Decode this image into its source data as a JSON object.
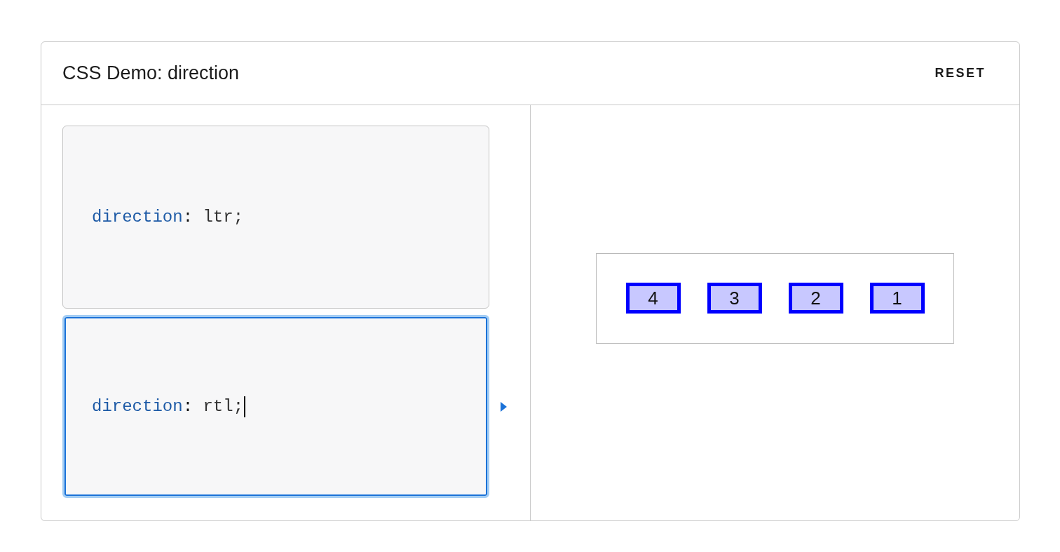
{
  "demo": {
    "title": "CSS Demo: direction",
    "reset_button": "RESET"
  },
  "examples": [
    {
      "selected": false,
      "tokens": [
        {
          "kind": "property",
          "text": "direction"
        },
        {
          "kind": "punctuation",
          "text": ": "
        },
        {
          "kind": "value",
          "text": "ltr;"
        }
      ]
    },
    {
      "selected": true,
      "tokens": [
        {
          "kind": "property",
          "text": "direction"
        },
        {
          "kind": "punctuation",
          "text": ": "
        },
        {
          "kind": "value",
          "text": "rtl;"
        }
      ]
    }
  ],
  "output": {
    "items": [
      "4",
      "3",
      "2",
      "1"
    ]
  }
}
